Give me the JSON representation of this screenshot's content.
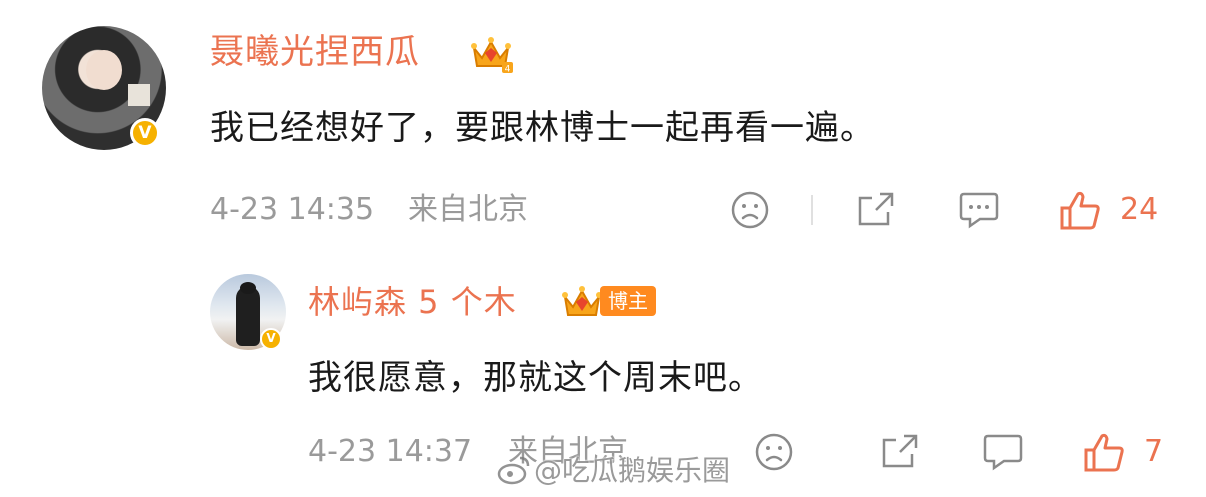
{
  "comment": {
    "username": "聂曦光捏西瓜",
    "text": "我已经想好了，要跟林博士一起再看一遍。",
    "time": "4-23 14:35",
    "location": "来自北京",
    "likes": "24"
  },
  "reply": {
    "username": "林屿森 5 个木",
    "badge": "博主",
    "text": "我很愿意，那就这个周末吧。",
    "time": "4-23 14:37",
    "location": "来自北京",
    "likes": "7"
  },
  "watermark": {
    "text": "@吃瓜鹅娱乐圈"
  },
  "colors": {
    "accent": "#eb7350",
    "text": "#1a1a1a",
    "meta": "#9a9a9a",
    "verified": "#f6b100"
  }
}
